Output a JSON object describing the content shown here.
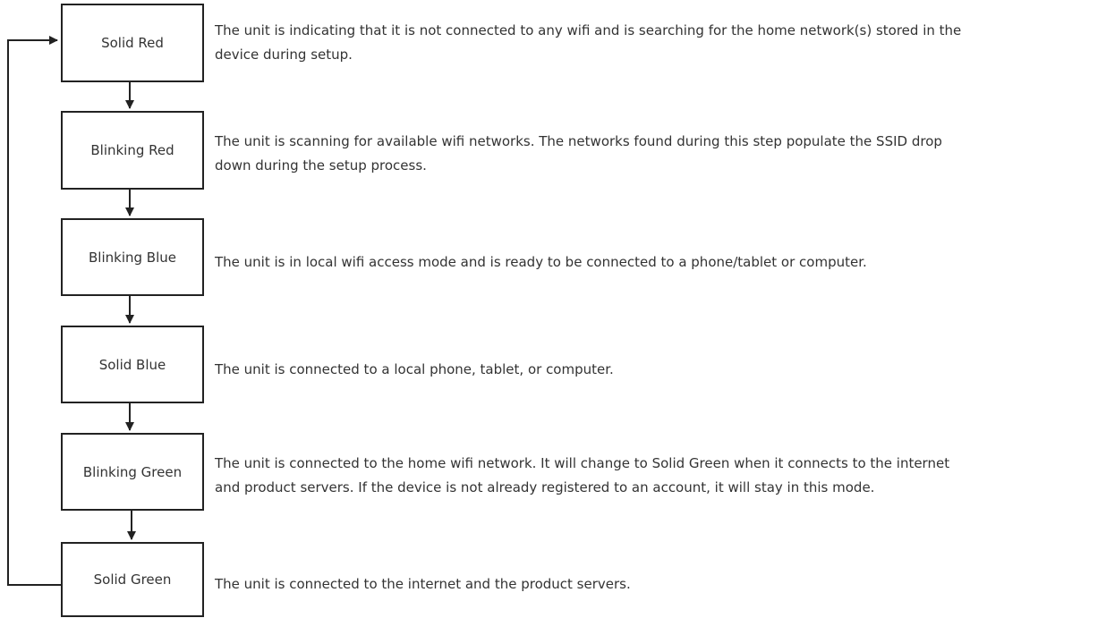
{
  "states": [
    {
      "label": "Solid Red",
      "description_lines": [
        "The unit is indicating that it is not connected to any wifi and is searching for the home network(s) stored in the",
        "device during setup."
      ]
    },
    {
      "label": "Blinking Red",
      "description_lines": [
        "The unit is scanning for available wifi networks.  The networks found during this step populate the SSID drop",
        "down during the setup process."
      ]
    },
    {
      "label": "Blinking Blue",
      "description_lines": [
        "The unit is in local wifi access mode and is ready to be connected to a phone/tablet or computer."
      ]
    },
    {
      "label": "Solid Blue",
      "description_lines": [
        "The unit is connected to a local phone, tablet, or computer."
      ]
    },
    {
      "label": "Blinking Green",
      "description_lines": [
        "The unit is connected to the home wifi network.  It will change to Solid Green when it connects to the internet",
        "and product servers.  If the device is not already registered to an account, it will stay in this mode."
      ]
    },
    {
      "label": "Solid Green",
      "description_lines": [
        "The unit is connected to the internet and the product servers."
      ]
    }
  ],
  "colors": {
    "line": "#222222",
    "text": "#333333",
    "background": "#ffffff"
  }
}
